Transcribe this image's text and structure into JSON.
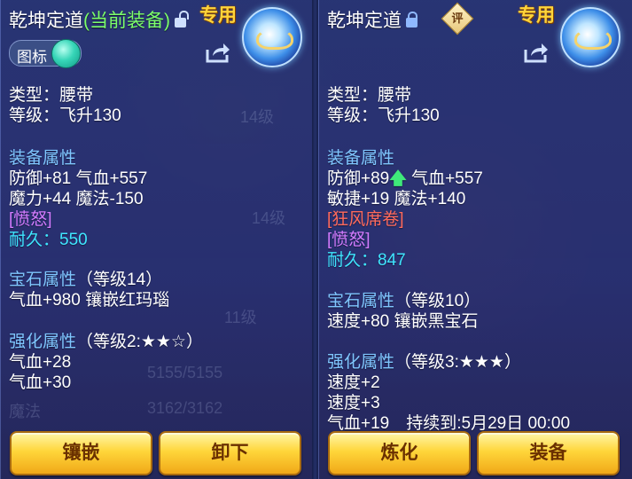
{
  "left_panel": {
    "title": "乾坤定道",
    "tag": "(当前装备)",
    "exclusive": "专用",
    "icon_toggle_label": "图标",
    "type_line": "类型：腰带",
    "level_line": "等级：飞升130",
    "equip_attr_header": "装备属性",
    "attr_line1": "防御+81 气血+557",
    "attr_line2": "魔力+44 魔法-150",
    "special": "[愤怒]",
    "durability": "耐久：550",
    "gem_header": "宝石属性",
    "gem_level": "（等级14）",
    "gem_line": "气血+980 镶嵌红玛瑙",
    "enhance_header": "强化属性",
    "enhance_level": "（等级2:★★☆）",
    "enhance_line1": "气血+28",
    "enhance_line2": "气血+30",
    "button1": "镶嵌",
    "button2": "卸下"
  },
  "right_panel": {
    "title": "乾坤定道",
    "rating_badge": "评",
    "exclusive": "专用",
    "type_line": "类型：腰带",
    "level_line": "等级：飞升130",
    "equip_attr_header": "装备属性",
    "attr_line1_a": "防御+89",
    "attr_line1_b": "气血+557",
    "attr_line2": "敏捷+19 魔法+140",
    "special_red": "[狂风席卷]",
    "special_purple": "[愤怒]",
    "durability": "耐久：847",
    "gem_header": "宝石属性",
    "gem_level": "（等级10）",
    "gem_line": "速度+80 镶嵌黑宝石",
    "enhance_header": "强化属性",
    "enhance_level": "（等级3:★★★）",
    "enhance_line1": "速度+2",
    "enhance_line2": "速度+3",
    "enhance_line3": "气血+19　持续到:5月29日 00:00",
    "button1": "炼化",
    "button2": "装备"
  },
  "background_ghost_text": {
    "hp": "5155/5155",
    "mp_label": "魔法",
    "mp": "3162/3162",
    "lv1": "14级",
    "lv2": "11级"
  },
  "colors": {
    "title_tag": "#7cff6a",
    "section_header": "#7fc6ff",
    "special_purple": "#d37bff",
    "special_red": "#ff6a5c",
    "durability": "#3fe6ff",
    "button_fill": "#ffd63a"
  }
}
